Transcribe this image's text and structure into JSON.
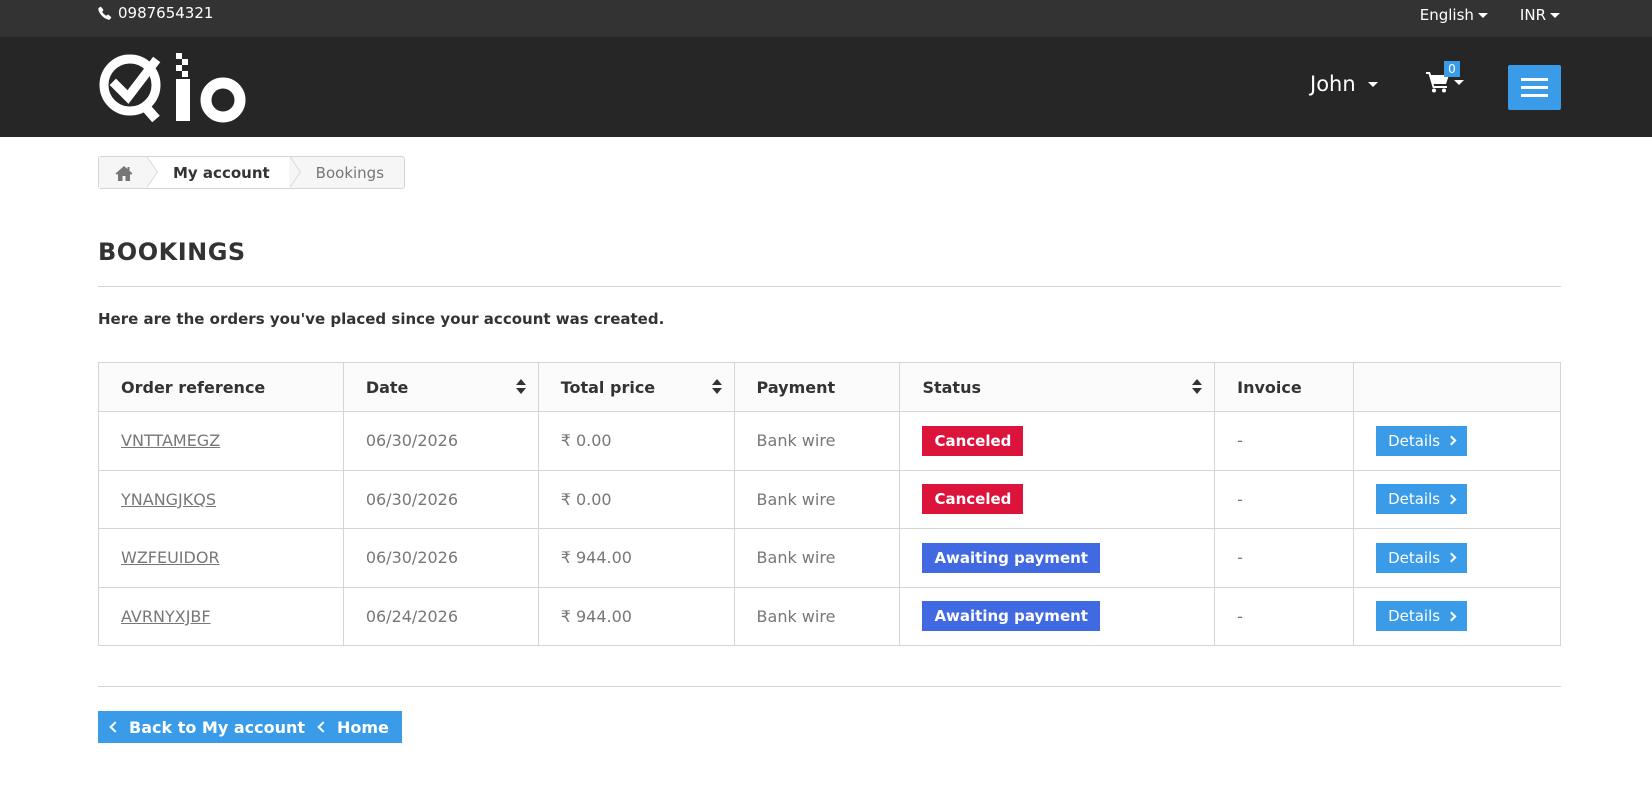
{
  "topbar": {
    "phone": "0987654321",
    "language": "English",
    "currency": "INR"
  },
  "header": {
    "user": "John",
    "cart_count": "0"
  },
  "breadcrumb": {
    "account": "My account",
    "current": "Bookings"
  },
  "page": {
    "title": "BOOKINGS",
    "intro": "Here are the orders you've placed since your account was created."
  },
  "table": {
    "headers": [
      "Order reference",
      "Date",
      "Total price",
      "Payment",
      "Status",
      "Invoice",
      ""
    ],
    "rows": [
      {
        "ref": "VNTTAMEGZ",
        "date": "06/30/2026",
        "total": "₹ 0.00",
        "payment": "Bank wire",
        "status": "Canceled",
        "invoice": "-",
        "action": "Details"
      },
      {
        "ref": "YNANGJKQS",
        "date": "06/30/2026",
        "total": "₹ 0.00",
        "payment": "Bank wire",
        "status": "Canceled",
        "invoice": "-",
        "action": "Details"
      },
      {
        "ref": "WZFEUIDOR",
        "date": "06/30/2026",
        "total": "₹ 944.00",
        "payment": "Bank wire",
        "status": "Awaiting payment",
        "invoice": "-",
        "action": "Details"
      },
      {
        "ref": "AVRNYXJBF",
        "date": "06/24/2026",
        "total": "₹ 944.00",
        "payment": "Bank wire",
        "status": "Awaiting payment",
        "invoice": "-",
        "action": "Details"
      }
    ]
  },
  "footer_buttons": {
    "back": "Back to My account",
    "home": "Home"
  },
  "colors": {
    "accent": "#3a9be8",
    "canceled": "#dc143c",
    "awaiting": "#4169e1",
    "header_bg": "#262626"
  }
}
